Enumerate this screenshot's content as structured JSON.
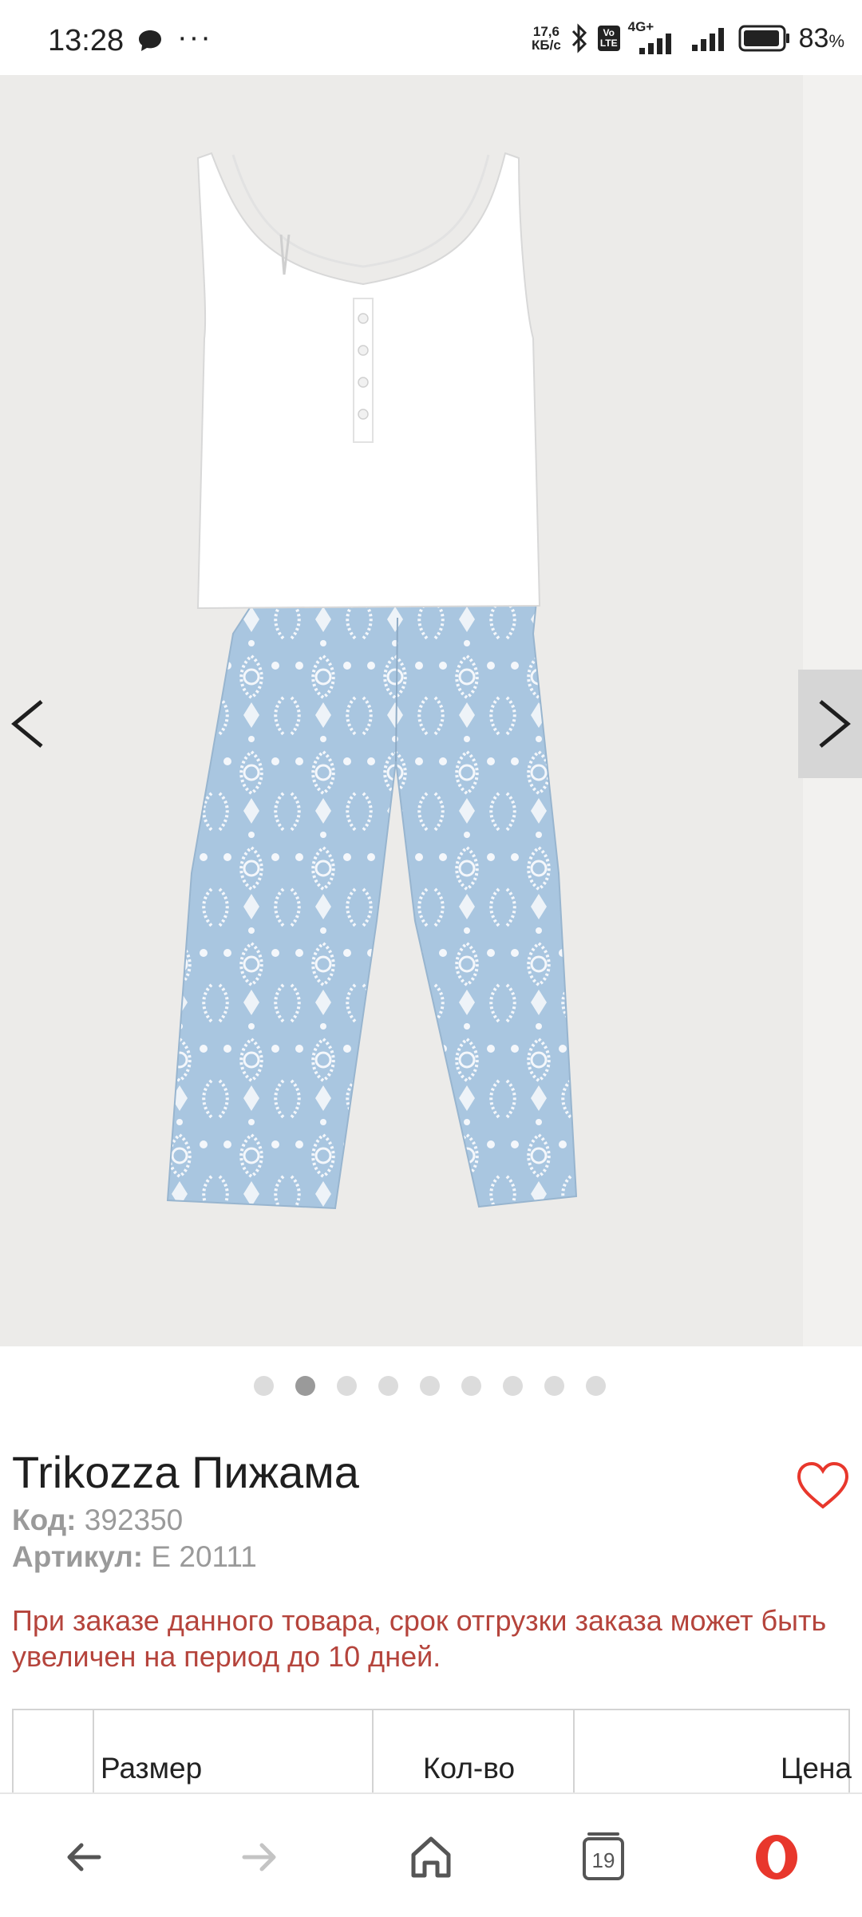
{
  "status_bar": {
    "time": "13:28",
    "net_speed_value": "17,6",
    "net_speed_unit": "КБ/с",
    "volte_top": "Vo",
    "volte_bottom": "LTE",
    "network": "4G+",
    "battery_pct": "83",
    "battery_suffix": "%",
    "icons": [
      "message-icon",
      "more-dots-icon",
      "bluetooth-icon",
      "volte-icon",
      "signal-icon",
      "signal-icon",
      "battery-icon"
    ]
  },
  "gallery": {
    "image_count": 9,
    "active_index": 1,
    "prev_icon": "chevron-left-icon",
    "next_icon": "chevron-right-icon"
  },
  "product": {
    "title": "Trikozza Пижама",
    "code_label": "Код:",
    "code_value": "392350",
    "article_label": "Артикул:",
    "article_value": "Е 20111",
    "notice": "При заказе данного товара, срок отгрузки заказа может быть увеличен на период до 10 дней.",
    "favorite_icon": "heart-outline-icon"
  },
  "table": {
    "headers": [
      "",
      "Размер",
      "Кол-во",
      "Цена"
    ]
  },
  "bottom_nav": {
    "tabs_count": "19",
    "icons": [
      "back-arrow-icon",
      "forward-arrow-icon",
      "home-icon",
      "tabs-icon",
      "opera-menu-icon"
    ]
  },
  "colors": {
    "accent": "#e8372c",
    "notice_text": "#b5443c",
    "gallery_bg": "#ecebe9",
    "pants_blue": "#a9c6e0"
  }
}
